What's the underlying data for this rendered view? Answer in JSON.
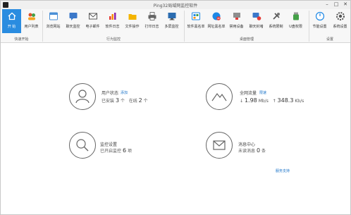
{
  "window": {
    "title": "Ping32局域网监控软件",
    "minimize": "–",
    "maximize": "□",
    "close": "✕"
  },
  "ribbon": {
    "groups": {
      "quick_start": "快速开始",
      "behavior": "行为监控",
      "desktop": "桌面管理",
      "settings": "设置"
    },
    "tools": {
      "start": "开 始",
      "user_list": "用户列表",
      "browse": "浏览网站",
      "chat": "聊天监控",
      "email": "电子邮件",
      "software": "软件日志",
      "file_op": "文件操作",
      "print": "打印日志",
      "multiscreen": "多屏监控",
      "soft_blacklist": "软件黑名单",
      "web_blacklist": "网址黑名单",
      "device_disable": "禁用设备",
      "chat_block": "聊天封堵",
      "sys_restrict": "系统限制",
      "udisk": "U盘权限",
      "energy": "节能设置",
      "sys_settings": "系统设置"
    }
  },
  "cards": {
    "users": {
      "title": "用户状态",
      "link": "添加",
      "installed_label": "已安装",
      "installed_count": "3",
      "unit_a": "个",
      "online_label": "在线",
      "online_count": "2",
      "unit_b": "个"
    },
    "traffic": {
      "title": "全网流量",
      "link": "限速",
      "down_arrow": "↓",
      "down_value": "1.98",
      "down_unit": "Mb/s",
      "up_arrow": "↑",
      "up_value": "348.3",
      "up_unit": "Kb/s"
    },
    "monitor": {
      "title": "监控设置",
      "enabled_label": "已开启监控",
      "enabled_count": "6",
      "unit": "项"
    },
    "messages": {
      "title": "消息中心",
      "unread_label": "未读消息",
      "unread_count": "0",
      "unit": "条"
    }
  },
  "footer_link": "服务支持",
  "colors": {
    "accent": "#2a8ce0",
    "link": "#1a73c9"
  }
}
